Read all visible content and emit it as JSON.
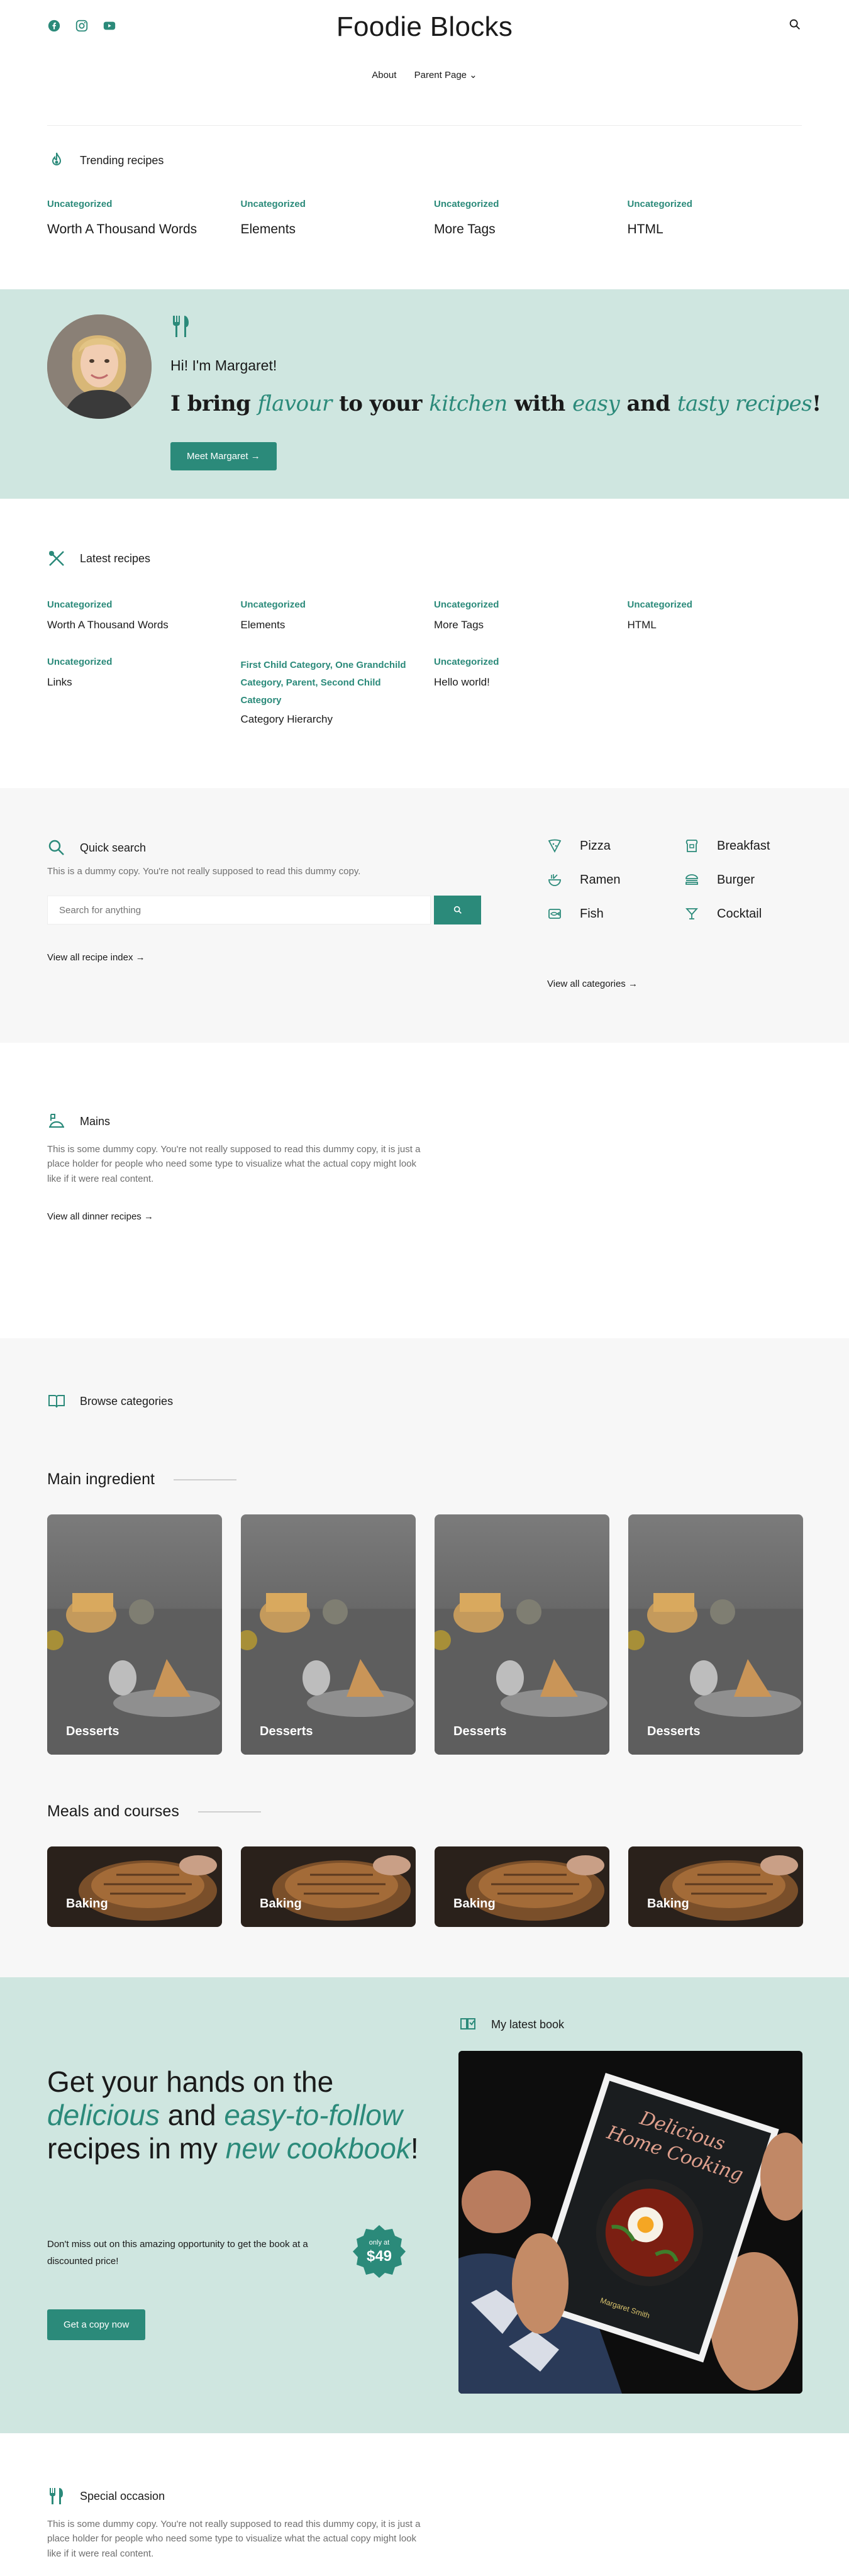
{
  "site": {
    "title": "Foodie Blocks"
  },
  "nav": {
    "items": [
      "About",
      "Parent Page ⌄"
    ]
  },
  "icons": {
    "social": [
      "facebook-icon",
      "instagram-icon",
      "youtube-icon"
    ],
    "search": "search-icon"
  },
  "colors": {
    "accent": "#2b8a7a",
    "hero_bg": "#cfe6e0",
    "light_bg": "#f7f7f7"
  },
  "trending": {
    "heading": "Trending recipes",
    "posts": [
      {
        "category": "Uncategorized",
        "title": "Worth A Thousand Words"
      },
      {
        "category": "Uncategorized",
        "title": "Elements"
      },
      {
        "category": "Uncategorized",
        "title": "More Tags"
      },
      {
        "category": "Uncategorized",
        "title": "HTML"
      }
    ]
  },
  "hero": {
    "greeting": "Hi! I'm Margaret!",
    "tagline": {
      "a": "I bring ",
      "b": "flavour",
      "c": " to your ",
      "d": "kitchen",
      "e": " with ",
      "f": "easy",
      "g": " and ",
      "h": "tasty recipes",
      "i": "!"
    },
    "button": "Meet Margaret →"
  },
  "latest": {
    "heading": "Latest recipes",
    "posts": [
      {
        "category": "Uncategorized",
        "title": "Worth A Thousand Words"
      },
      {
        "category": "Uncategorized",
        "title": "Elements"
      },
      {
        "category": "Uncategorized",
        "title": "More Tags"
      },
      {
        "category": "Uncategorized",
        "title": "HTML"
      },
      {
        "category": "Uncategorized",
        "title": "Links"
      },
      {
        "category": "First Child Category, One Grandchild Category, Parent, Second Child Category",
        "title": "Category Hierarchy"
      },
      {
        "category": "Uncategorized",
        "title": "Hello world!"
      }
    ]
  },
  "quick_search": {
    "heading": "Quick search",
    "description": "This is a dummy copy. You're not really supposed to read this dummy copy.",
    "placeholder": "Search for anything",
    "view_link": "View all recipe index →",
    "categories": [
      "Pizza",
      "Breakfast",
      "Ramen",
      "Burger",
      "Fish",
      "Cocktail"
    ],
    "view_categories": "View all categories →"
  },
  "mains": {
    "heading": "Mains",
    "description": "This is some dummy copy. You're not really supposed to read this dummy copy, it is just a place holder for people who need some type to visualize what the actual copy might look like if it were real content.",
    "link": "View all dinner recipes →"
  },
  "browse": {
    "heading": "Browse categories",
    "main_ingredient": {
      "title": "Main ingredient",
      "cards": [
        "Desserts",
        "Desserts",
        "Desserts",
        "Desserts"
      ]
    },
    "meals": {
      "title": "Meals and courses",
      "cards": [
        "Baking",
        "Baking",
        "Baking",
        "Baking"
      ]
    }
  },
  "book": {
    "heading": {
      "a": "Get your hands on the ",
      "b": "delicious",
      "c": " and ",
      "d": "easy-to-follow",
      "e": " recipes in my ",
      "f": "new cookbook",
      "g": "!"
    },
    "description": "Don't miss out on this amazing opportunity to get the book at a discounted price!",
    "badge_small": "only at",
    "badge_price": "$49",
    "button": "Get a copy now",
    "label": "My latest book",
    "cover_title": "Delicious Home Cooking",
    "cover_author": "Margaret Smith"
  },
  "special": {
    "heading": "Special occasion",
    "description": "This is some dummy copy. You're not really supposed to read this dummy copy, it is just a place holder for people who need some type to visualize what the actual copy might look like if it were real content."
  }
}
